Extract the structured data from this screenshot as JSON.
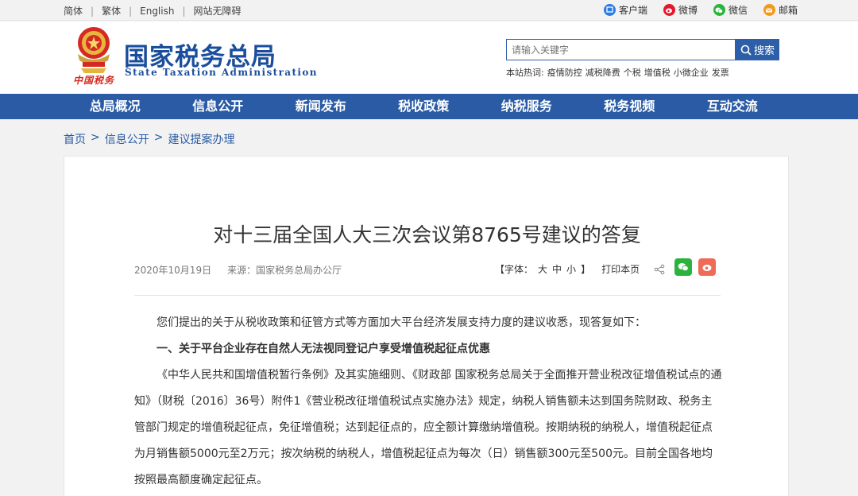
{
  "topbar": {
    "langs": [
      "简体",
      "繁体",
      "English",
      "网站无障碍"
    ],
    "socials": [
      {
        "label": "客户端",
        "icon": "client-icon",
        "color": "#2a7be4"
      },
      {
        "label": "微博",
        "icon": "weibo-icon",
        "color": "#e6162d"
      },
      {
        "label": "微信",
        "icon": "wechat-icon",
        "color": "#2bb33d"
      },
      {
        "label": "邮箱",
        "icon": "mail-icon",
        "color": "#f39a1e"
      }
    ]
  },
  "header": {
    "brand_cn": "国家税务总局",
    "brand_en": "State Taxation Administration",
    "emblem_text": "中国税务",
    "search_placeholder": "请输入关键字",
    "search_button": "搜索",
    "hot_label": "本站热词:",
    "hot_words": [
      "疫情防控",
      "减税降费",
      "个税",
      "增值税",
      "小微企业",
      "发票"
    ]
  },
  "nav": [
    "总局概况",
    "信息公开",
    "新闻发布",
    "税收政策",
    "纳税服务",
    "税务视频",
    "互动交流"
  ],
  "breadcrumb": [
    "首页",
    ">",
    "信息公开",
    ">",
    "建议提案办理"
  ],
  "article": {
    "title": "对十三届全国人大三次会议第8765号建议的答复",
    "date": "2020年10月19日",
    "source": "来源：国家税务总局办公厅",
    "font_label": "【字体：",
    "font_large": "大",
    "font_medium": "中",
    "font_small": "小",
    "font_close": "】",
    "print": "打印本页",
    "paragraphs": [
      "您们提出的关于从税收政策和征管方式等方面加大平台经济发展支持力度的建议收悉，现答复如下：",
      "一、关于平台企业存在自然人无法视同登记户享受增值税起征点优惠",
      "《中华人民共和国增值税暂行条例》及其实施细则、《财政部 国家税务总局关于全面推开营业税改征增值税试点的通知》（财税〔2016〕36号）附件1《营业税改征增值税试点实施办法》规定，纳税人销售额未达到国务院财政、税务主管部门规定的增值税起征点，免征增值税；达到起征点的，应全额计算缴纳增值税。按期纳税的纳税人，增值税起征点为月销售额5000元至2万元；按次纳税的纳税人，增值税起征点为每次（日）销售额300元至500元。目前全国各地均按照最高额度确定起征点。"
    ]
  },
  "colors": {
    "accent": "#2a5ba4",
    "brand": "#1a4e9c"
  }
}
